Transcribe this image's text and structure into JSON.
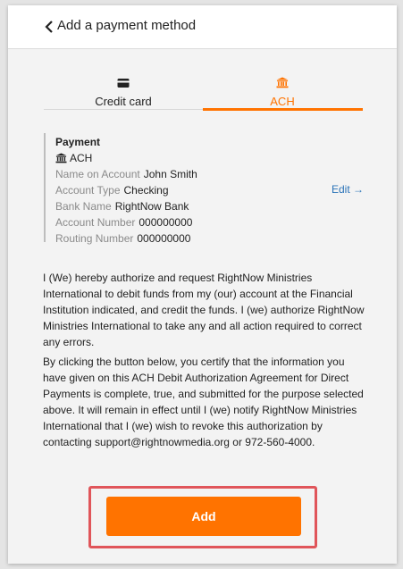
{
  "header": {
    "title": "Add a payment method",
    "back_icon": "chevron-left-icon"
  },
  "tabs": [
    {
      "label": "Credit card",
      "icon": "credit-card-icon",
      "active": false
    },
    {
      "label": "ACH",
      "icon": "bank-icon",
      "active": true
    }
  ],
  "colors": {
    "accent": "#ff7300",
    "link": "#2a73b8",
    "highlight": "#e0555a"
  },
  "payment": {
    "heading": "Payment",
    "method": "ACH",
    "method_icon": "bank-icon",
    "fields": [
      {
        "key": "Name on Account",
        "value": "John Smith"
      },
      {
        "key": "Account Type",
        "value": "Checking"
      },
      {
        "key": "Bank Name",
        "value": "RightNow Bank"
      },
      {
        "key": "Account Number",
        "value": "000000000"
      },
      {
        "key": "Routing Number",
        "value": "000000000"
      }
    ],
    "edit_label": "Edit →"
  },
  "authorization": {
    "paragraph1": "I (We) hereby authorize and request RightNow Ministries International to debit funds from my (our) account at the Financial Institution indicated, and credit the funds. I (we) authorize RightNow Ministries International to take any and all action required to correct any errors.",
    "paragraph2": "By clicking the button below, you certify that the information you have given on this ACH Debit Authorization Agreement for Direct Payments is complete, true, and submitted for the purpose selected above. It will remain in effect until I (we) notify RightNow Ministries International that I (we) wish to revoke this authorization by contacting support@rightnowmedia.org or 972-560-4000."
  },
  "add_button": {
    "label": "Add"
  }
}
